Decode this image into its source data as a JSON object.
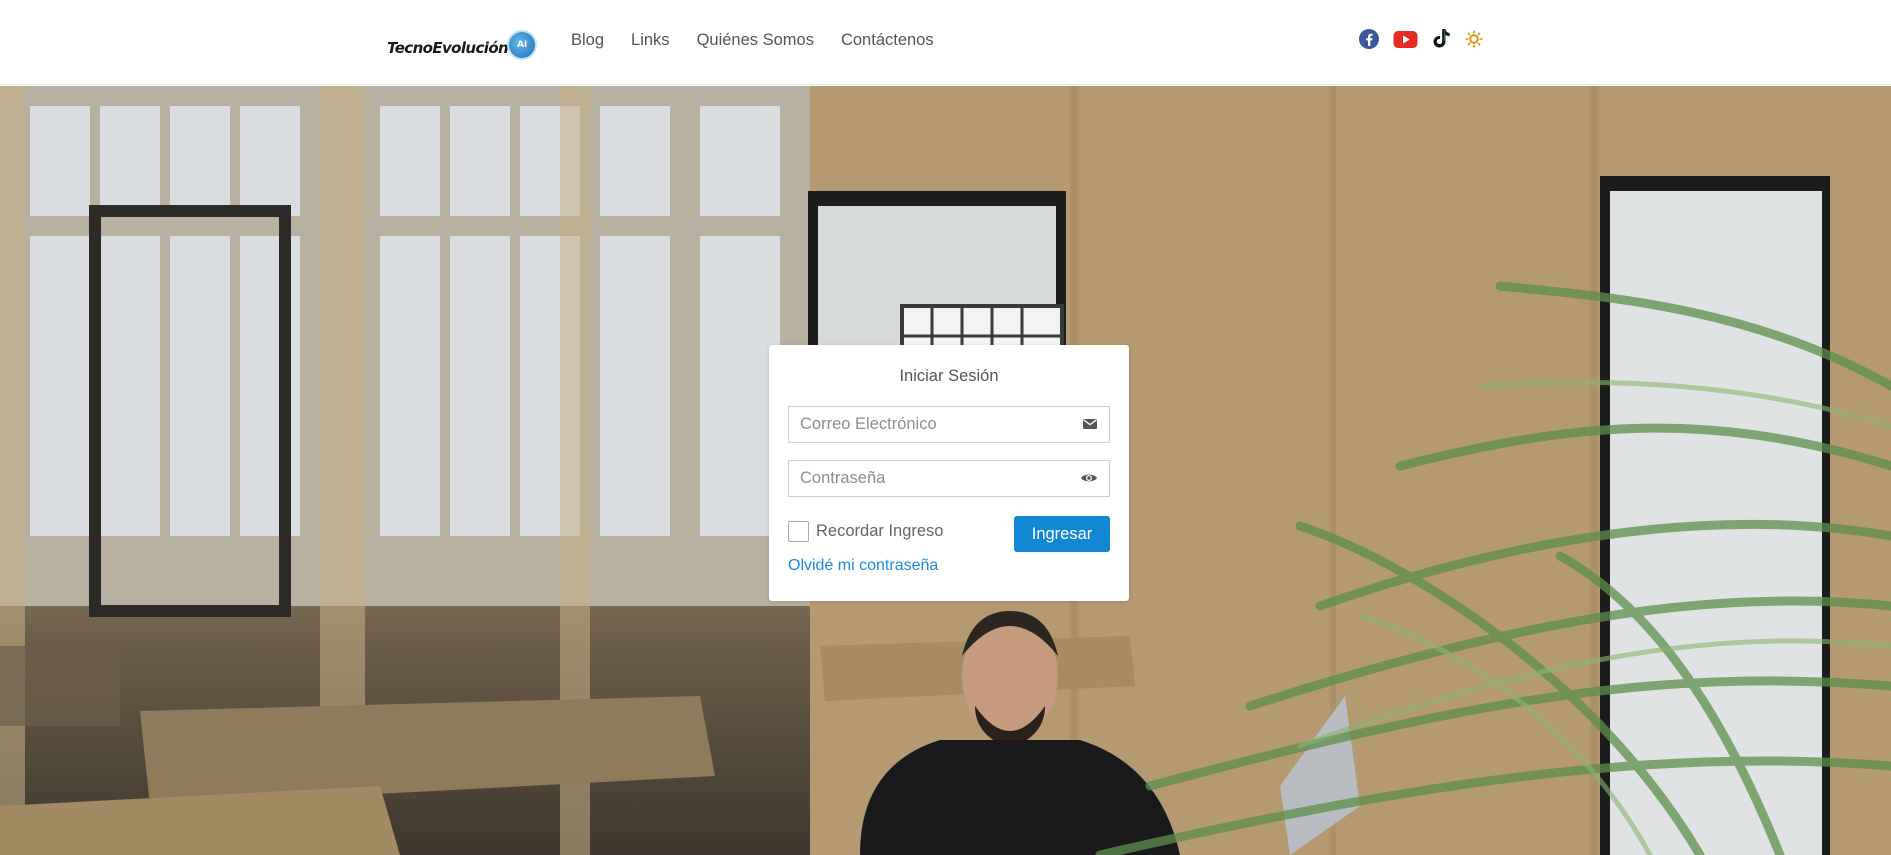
{
  "header": {
    "logo_text": "TecnoEvolución",
    "logo_badge": "AI",
    "nav": [
      {
        "label": "Blog"
      },
      {
        "label": "Links"
      },
      {
        "label": "Quiénes Somos"
      },
      {
        "label": "Contáctenos"
      }
    ],
    "social": [
      {
        "icon": "facebook-icon",
        "color": "#3b5998"
      },
      {
        "icon": "youtube-icon",
        "color": "#e52d27"
      },
      {
        "icon": "tiktok-icon",
        "color": "#111111"
      },
      {
        "icon": "theme-toggle-sun-icon",
        "color": "#e08b00"
      }
    ]
  },
  "login": {
    "title": "Iniciar Sesión",
    "email_placeholder": "Correo Electrónico",
    "email_icon": "envelope-icon",
    "password_placeholder": "Contraseña",
    "password_icon": "eye-icon",
    "remember_label": "Recordar Ingreso",
    "remember_checked": false,
    "submit_label": "Ingresar",
    "forgot_label": "Olvidé mi contraseña"
  },
  "colors": {
    "primary_button": "#1287d3",
    "link": "#1c8ae2",
    "nav_text": "#555555"
  }
}
